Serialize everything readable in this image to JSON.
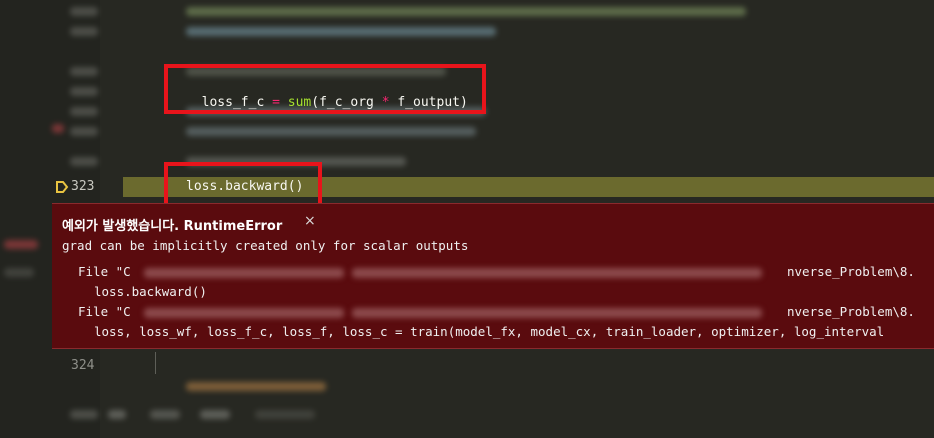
{
  "editor": {
    "visible_code": {
      "loss_line": {
        "var": "loss_f_c",
        "op": " = ",
        "fn": "sum",
        "open": "(",
        "arg1": "f_c_org",
        "mul": " * ",
        "arg2": "f_output",
        "close": ")"
      },
      "current_line": "loss.backward()"
    },
    "line_numbers": {
      "current": "323",
      "next": "324"
    }
  },
  "exception": {
    "title_korean": "예외가 발생했습니다.",
    "title_type": "RuntimeError",
    "close_glyph": "×",
    "message": "grad can be implicitly created only for scalar outputs",
    "traceback": [
      {
        "file_prefix": "File \"C",
        "file_suffix": "nverse_Problem\\8.",
        "code": "loss.backward()"
      },
      {
        "file_prefix": "File \"C",
        "file_suffix": "nverse_Problem\\8.",
        "code": "loss, loss_wf, loss_f_c, loss_f, loss_c = train(model_fx, model_cx, train_loader, optimizer, log_interval"
      }
    ]
  },
  "colors": {
    "editor_bg": "#272822",
    "highlight": "#6b6a2e",
    "error_bg": "#5a0b0e",
    "annotation_red": "#e8141b",
    "keyword_pink": "#f92672",
    "function_green": "#a6e22e"
  },
  "icons": [
    "breakpoint-arrow-icon",
    "close-icon"
  ]
}
